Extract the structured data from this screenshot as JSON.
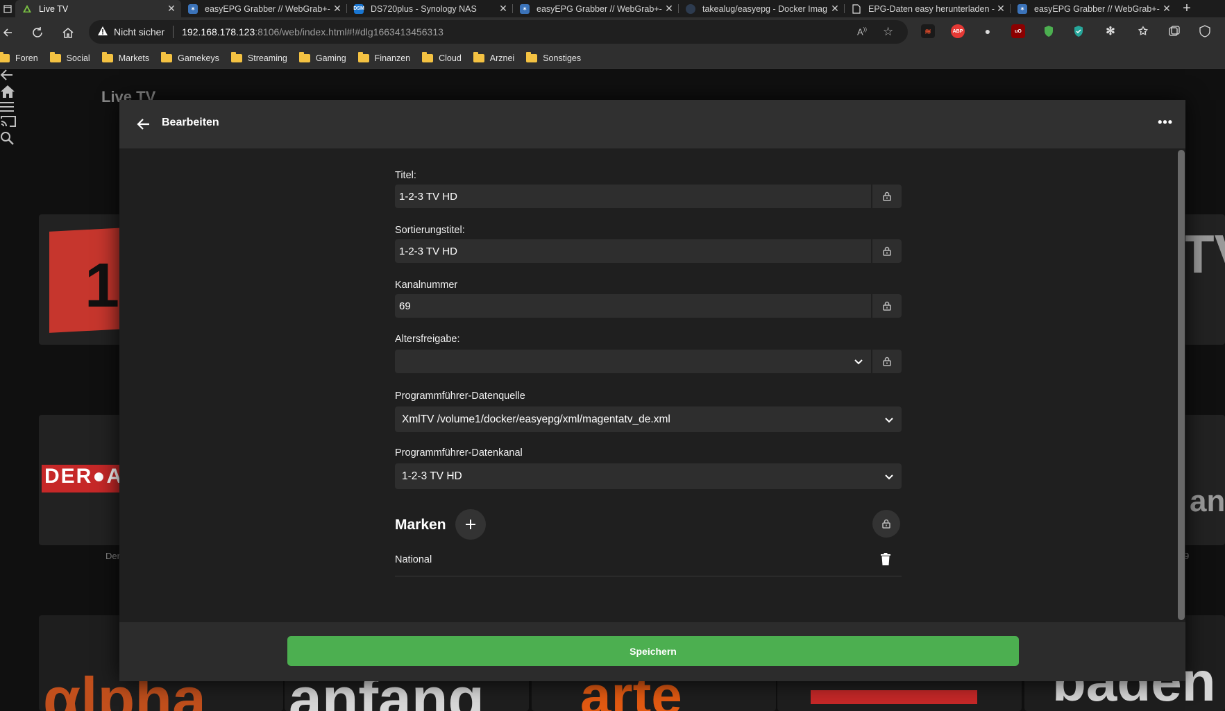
{
  "browser": {
    "tabs": [
      {
        "title": "Live TV",
        "active": true,
        "favicon": "jellyfin-icon",
        "favicon_color": "#00a4dc"
      },
      {
        "title": "easyEPG Grabber // WebGrab+-",
        "active": false,
        "favicon": "easyepg-icon",
        "favicon_color": "#3b73b9"
      },
      {
        "title": "DS720plus - Synology NAS",
        "active": false,
        "favicon": "dsm-icon",
        "favicon_color": "#1976d2"
      },
      {
        "title": "easyEPG Grabber // WebGrab+-",
        "active": false,
        "favicon": "easyepg-icon",
        "favicon_color": "#3b73b9"
      },
      {
        "title": "takealug/easyepg - Docker Imag",
        "active": false,
        "favicon": "docker-icon",
        "favicon_color": "#2d3b4f"
      },
      {
        "title": "EPG-Daten easy herunterladen -",
        "active": false,
        "favicon": "page-icon",
        "favicon_color": "#00000000"
      },
      {
        "title": "easyEPG Grabber // WebGrab+-",
        "active": false,
        "favicon": "easyepg-icon",
        "favicon_color": "#3b73b9"
      }
    ],
    "address": {
      "security_label": "Nicht sicher",
      "host": "192.168.178.123",
      "path": ":8106/web/index.html#!#dlg1663413456313"
    },
    "bookmarks": [
      "Foren",
      "Social",
      "Markets",
      "Gamekeys",
      "Streaming",
      "Gaming",
      "Finanzen",
      "Cloud",
      "Arznei",
      "Sonstiges"
    ]
  },
  "app": {
    "title": "Live TV",
    "tile_labels": {
      "left": "Der",
      "right": "9"
    }
  },
  "dialog": {
    "title": "Bearbeiten",
    "fields": {
      "title_label": "Titel:",
      "title_value": "1-2-3 TV HD",
      "sort_label": "Sortierungstitel:",
      "sort_value": "1-2-3 TV HD",
      "channel_label": "Kanalnummer",
      "channel_value": "69",
      "rating_label": "Altersfreigabe:",
      "rating_value": "",
      "epg_source_label": "Programmführer-Datenquelle",
      "epg_source_value": "XmlTV /volume1/docker/easyepg/xml/magentatv_de.xml",
      "epg_channel_label": "Programmführer-Datenkanal",
      "epg_channel_value": "1-2-3 TV HD"
    },
    "tags": {
      "section_title": "Marken",
      "items": [
        "National"
      ]
    },
    "save_label": "Speichern"
  },
  "colors": {
    "save_button": "#4caf50",
    "dialog_bg": "#1f1f1f",
    "header_bg": "#303030"
  }
}
